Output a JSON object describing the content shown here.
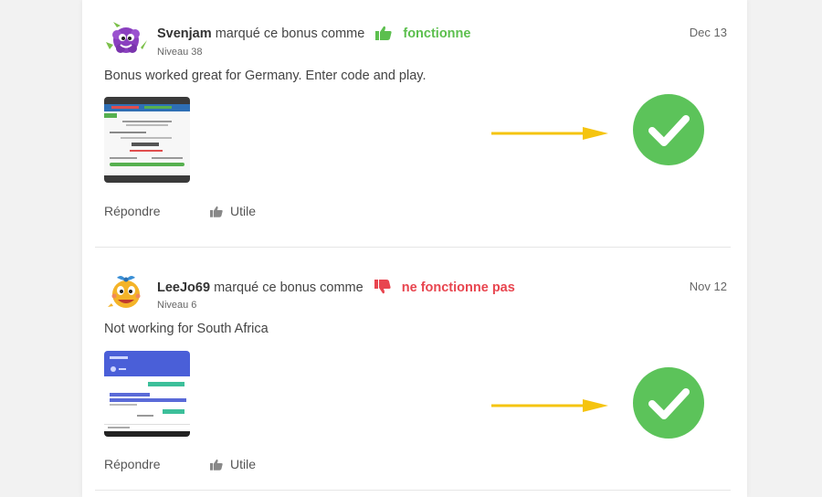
{
  "reviews": [
    {
      "username": "Svenjam",
      "action_text": "marqué ce bonus comme",
      "status": "fonctionne",
      "status_type": "works",
      "level": "Niveau 38",
      "date": "Dec 13",
      "comment": "Bonus worked great for Germany. Enter code and play.",
      "reply_label": "Répondre",
      "useful_label": "Utile",
      "avatar_icon": "purple-monster-avatar-icon",
      "annotation_icon": "green-checkmark-icon"
    },
    {
      "username": "LeeJo69",
      "action_text": "marqué ce bonus comme",
      "status": "ne fonctionne pas",
      "status_type": "not-works",
      "level": "Niveau 6",
      "date": "Nov 12",
      "comment": "Not working for South Africa",
      "reply_label": "Répondre",
      "useful_label": "Utile",
      "avatar_icon": "yellow-cartoon-face-avatar-icon",
      "annotation_icon": "green-checkmark-icon"
    }
  ],
  "colors": {
    "works": "#5cbf4e",
    "not_works": "#e8454f",
    "checkmark": "#5cc35a",
    "arrow": "#f5c40f"
  }
}
